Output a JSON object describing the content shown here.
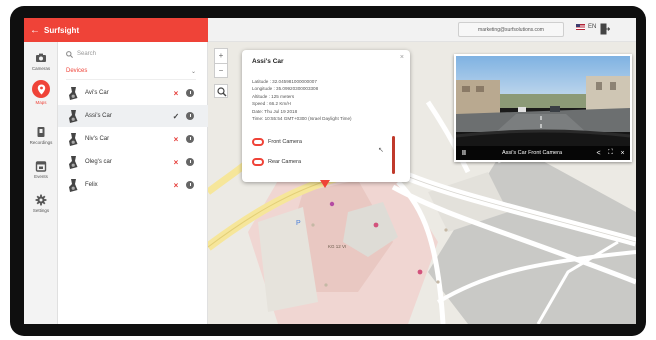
{
  "app": {
    "back_glyph": "←",
    "title": "Surfsight"
  },
  "header": {
    "email": "marketing@surfsolutions.com",
    "language": "EN"
  },
  "nav": [
    {
      "label": "Cameras",
      "icon": "camera-icon",
      "active": false
    },
    {
      "label": "Maps",
      "icon": "map-pin-icon",
      "active": true
    },
    {
      "label": "Recordings",
      "icon": "video-icon",
      "active": false
    },
    {
      "label": "Events",
      "icon": "calendar-icon",
      "active": false
    },
    {
      "label": "Settings",
      "icon": "gear-icon",
      "active": false
    }
  ],
  "panel": {
    "search_placeholder": "Search",
    "devices_label": "Devices",
    "chevron": "⌄",
    "devices": [
      {
        "name": "Avi's Car",
        "status": "×",
        "selected": false
      },
      {
        "name": "Assi's Car",
        "status": "✓",
        "selected": true
      },
      {
        "name": "Niv's Car",
        "status": "×",
        "selected": false
      },
      {
        "name": "Oleg's car",
        "status": "×",
        "selected": false
      },
      {
        "name": "Felix",
        "status": "×",
        "selected": false
      }
    ]
  },
  "map": {
    "zoom_in": "+",
    "zoom_out": "−",
    "labels": [
      {
        "text": "P"
      },
      {
        "text": "KG 12 VI"
      }
    ]
  },
  "popup": {
    "title": "Assi's Car",
    "close": "×",
    "details": [
      "Latitude : 32.045981000000007",
      "Longitude : 35.09920300003308",
      "Altitude : 125 meters",
      "Speed : 66.2 Km/H",
      "Date: Thu Jul 19 2018",
      "Time: 10:55:54 GMT+0300 (Israel Daylight Time)"
    ],
    "front_camera": "Front Camera",
    "rear_camera": "Rear Camera"
  },
  "video": {
    "title": "Assi's Car Front Camera",
    "pause": "II",
    "share": "<",
    "fullscreen": "⛶",
    "close": "×"
  },
  "colors": {
    "accent": "#ef4338",
    "nav_bg": "#f3f3f3",
    "map_bg": "#eceae4",
    "road_yellow": "#f6e69a"
  }
}
